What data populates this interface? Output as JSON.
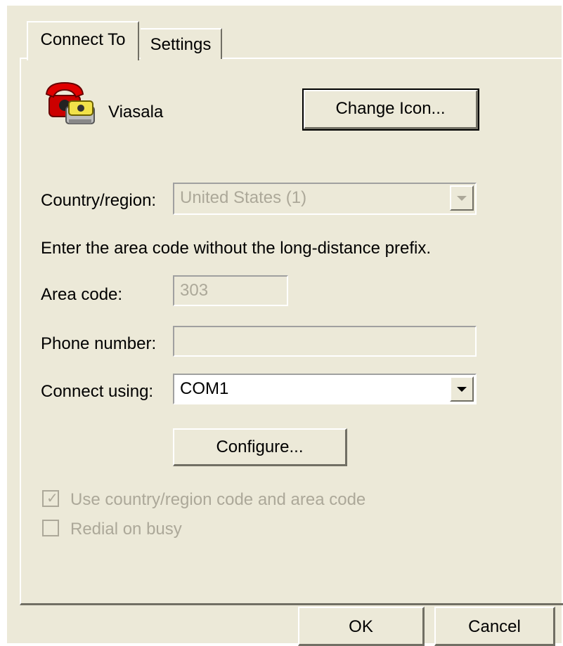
{
  "tabs": [
    {
      "label": "Connect To",
      "active": true
    },
    {
      "label": "Settings",
      "active": false
    }
  ],
  "connection": {
    "name": "Viasala",
    "icon": "telephone-icon",
    "change_icon_label": "Change Icon..."
  },
  "country": {
    "label": "Country/region:",
    "value": "United States (1)",
    "disabled": true
  },
  "instruction": "Enter the area code without the long-distance prefix.",
  "area_code": {
    "label": "Area code:",
    "value": "303",
    "disabled": true
  },
  "phone_number": {
    "label": "Phone number:",
    "value": "",
    "disabled": true
  },
  "connect_using": {
    "label": "Connect using:",
    "value": "COM1"
  },
  "configure_label": "Configure...",
  "checkboxes": [
    {
      "label": "Use country/region code and area code",
      "checked": true,
      "disabled": true
    },
    {
      "label": "Redial on busy",
      "checked": false,
      "disabled": true
    }
  ],
  "footer": {
    "ok_label": "OK",
    "cancel_label": "Cancel"
  },
  "colors": {
    "dialog_bg": "#ECE9D8",
    "disabled_text": "#ACA899",
    "shadow": "#716F64"
  }
}
